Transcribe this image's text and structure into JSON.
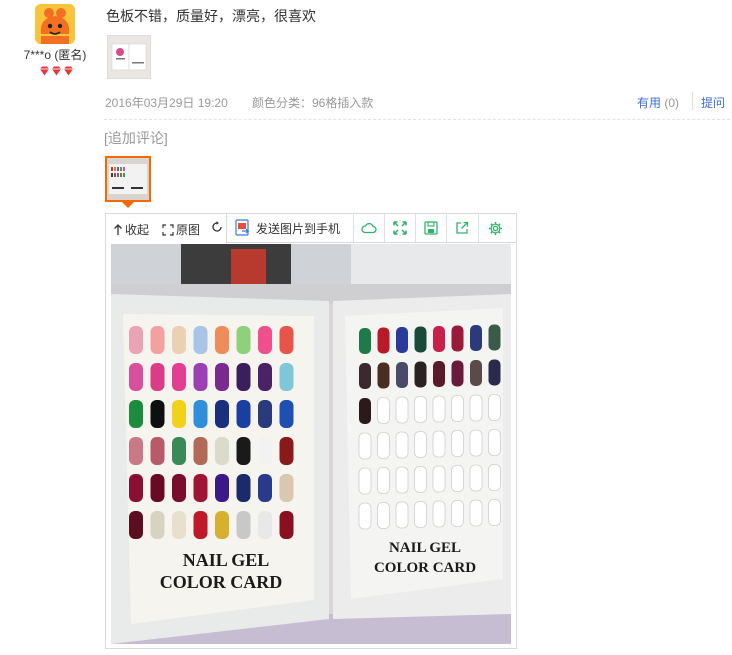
{
  "user": {
    "name": "7***o (匿名)",
    "avatar_color": "#f7c33a",
    "badge_count": 3,
    "badge_icon": "red-diamond-icon"
  },
  "review": {
    "text": "色板不错，质量好，漂亮，很喜欢",
    "date": "2016年03月29日 19:20",
    "color_category": "颜色分类：96格插入款",
    "useful_label": "有用",
    "useful_count": "(0)",
    "ask_label": "提问"
  },
  "followup": {
    "title": "[追加评论]"
  },
  "viewer": {
    "collapse_label": "收起",
    "original_label": "原图",
    "send_label": "发送图片到手机",
    "accent_color": "#2fb36a",
    "photo_text_line1": "NAIL GEL",
    "photo_text_line2": "COLOR CARD"
  }
}
